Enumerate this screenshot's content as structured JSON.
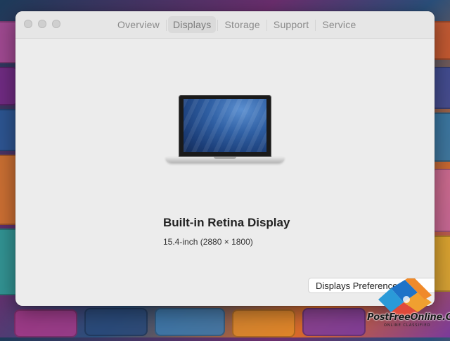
{
  "window": {
    "tabs": [
      {
        "label": "Overview",
        "active": false
      },
      {
        "label": "Displays",
        "active": true
      },
      {
        "label": "Storage",
        "active": false
      },
      {
        "label": "Support",
        "active": false
      },
      {
        "label": "Service",
        "active": false
      }
    ]
  },
  "display": {
    "name": "Built-in Retina Display",
    "spec": "15.4-inch (2880 × 1800)",
    "image_icon": "macbook-pro-icon"
  },
  "buttons": {
    "preferences_label": "Displays Preferences..."
  },
  "watermark": {
    "text": "PostFreeOnline.Com",
    "subtext": "ONLINE CLASSIFIED"
  },
  "colors": {
    "window_bg": "#ececec",
    "tab_active_bg": "#dadada",
    "text_primary": "#222222"
  }
}
